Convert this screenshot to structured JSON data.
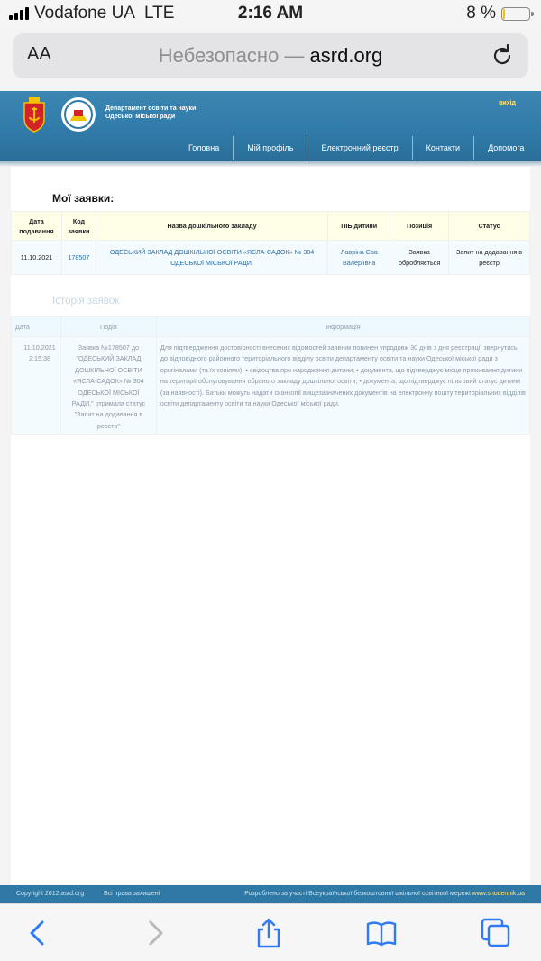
{
  "status_bar": {
    "carrier": "Vodafone UA",
    "network": "LTE",
    "time": "2:16 AM",
    "battery": "8 %",
    "battery_level": 0.08,
    "battery_color": "#f2c200"
  },
  "address_bar": {
    "text_size_label": "AA",
    "insecure_label": "Небезопасно —",
    "domain": "asrd.org",
    "reload_icon": "reload-icon"
  },
  "header": {
    "department": "Департамент освіти та науки Одеської міської ради",
    "exit": "вихід",
    "nav": [
      "Головна",
      "Мій профіль",
      "Електронний реєстр",
      "Контакти",
      "Допомога"
    ],
    "colors": {
      "bar": "#2f7aa8",
      "accent": "#ffe680"
    }
  },
  "applications": {
    "title": "Мої заявки:",
    "columns": [
      "Дата подавання",
      "Код заявки",
      "Назва дошкільного закладу",
      "ПІБ дитини",
      "Позиція",
      "Статус"
    ],
    "rows": [
      {
        "date": "11.10.2021",
        "code": "178507",
        "institution": "ОДЕСЬКИЙ ЗАКЛАД ДОШКІЛЬНОЇ ОСВІТИ «ЯСЛА-САДОК» № 304 ОДЕСЬКОЇ МІСЬКОЇ РАДИ.",
        "child": "Лавріна Єва Валеріївна",
        "position": "Заявка обробляється",
        "status": "Запит на додавання в реєстр"
      }
    ]
  },
  "history": {
    "title": "Історія заявок",
    "columns": [
      "Дата",
      "Подія",
      "Інформація"
    ],
    "rows": [
      {
        "datetime": "11.10.2021 2:15:38",
        "event": "Заявка №178507 до \"ОДЕСЬКИЙ ЗАКЛАД ДОШКІЛЬНОЇ ОСВІТИ «ЯСЛА-САДОК» № 304 ОДЕСЬКОЇ МІСЬКОЇ РАДИ.\" отримала статус \"Запит на додавання в реєстр\"",
        "info": "Для підтвердження достовірності внесених відомостей заявник повинен упродовж 30 днів з дня реєстрації звернутись до відповідного районного територіального відділу освіти департаменту освіти та науки Одеської міської ради з оригіналами (та їх копіями): • свідоцтва про народження дитини; • документа, що підтверджує місце проживання дитини на території обслуговування обраного закладу дошкільної освіти; • документа, що підтверджує пільговий статус дитини (за наявності). Батьки можуть надати сканкопії вищезазначених документів на електронну пошту територіальних відділів освіти департаменту освіти та науки Одеської міської ради."
      }
    ]
  },
  "footer": {
    "copyright": "Copyright 2012 asrd.org",
    "rights": "Всі права захищені",
    "made_by": "Розроблено за участі Всеукраїнської безкоштовної шкільної освітньої мережі",
    "made_by_link": "www.shodennik.ua"
  },
  "toolbar": {
    "icons": [
      "back-icon",
      "forward-icon",
      "share-icon",
      "bookmarks-icon",
      "tabs-icon"
    ],
    "accent": "#2f7bf6"
  }
}
